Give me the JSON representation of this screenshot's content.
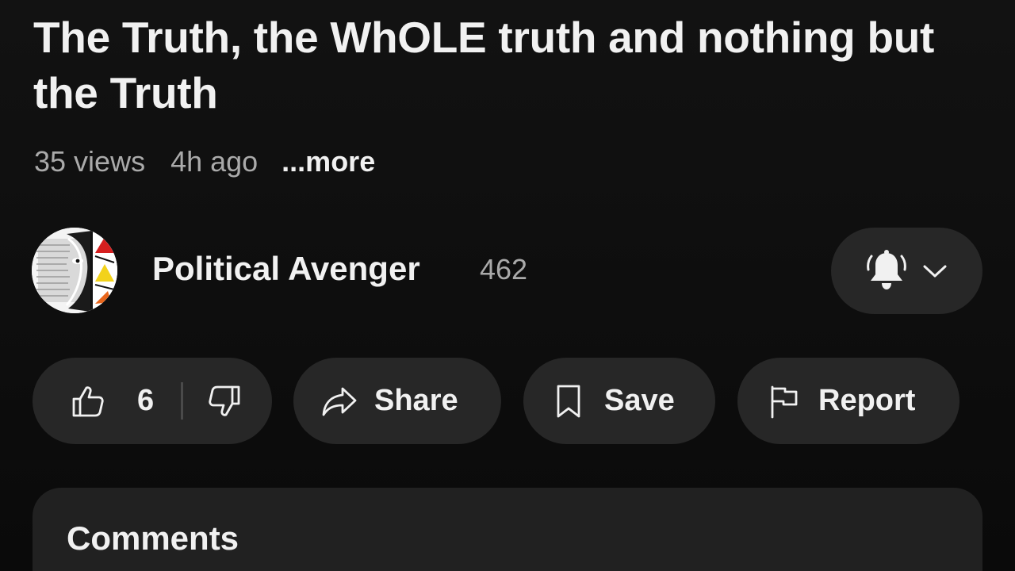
{
  "video": {
    "title": "The Truth, the WhOLE truth and nothing but the Truth",
    "views": "35 views",
    "age": "4h ago",
    "more_label": "...more"
  },
  "channel": {
    "name": "Political Avenger",
    "subscriber_count": "462",
    "avatar_icon": "channel-avatar-icon",
    "notification_icon": "bell-icon",
    "dropdown_icon": "chevron-down-icon"
  },
  "actions": {
    "like_count": "6",
    "like_icon": "thumbs-up-icon",
    "dislike_icon": "thumbs-down-icon",
    "share_label": "Share",
    "share_icon": "share-arrow-icon",
    "save_label": "Save",
    "save_icon": "bookmark-icon",
    "report_label": "Report",
    "report_icon": "flag-icon"
  },
  "comments": {
    "title": "Comments"
  },
  "colors": {
    "background": "#0f0f0f",
    "pill": "#272727",
    "comments_panel": "#212121",
    "text_primary": "#f1f1f1",
    "text_secondary": "#aaaaaa"
  }
}
